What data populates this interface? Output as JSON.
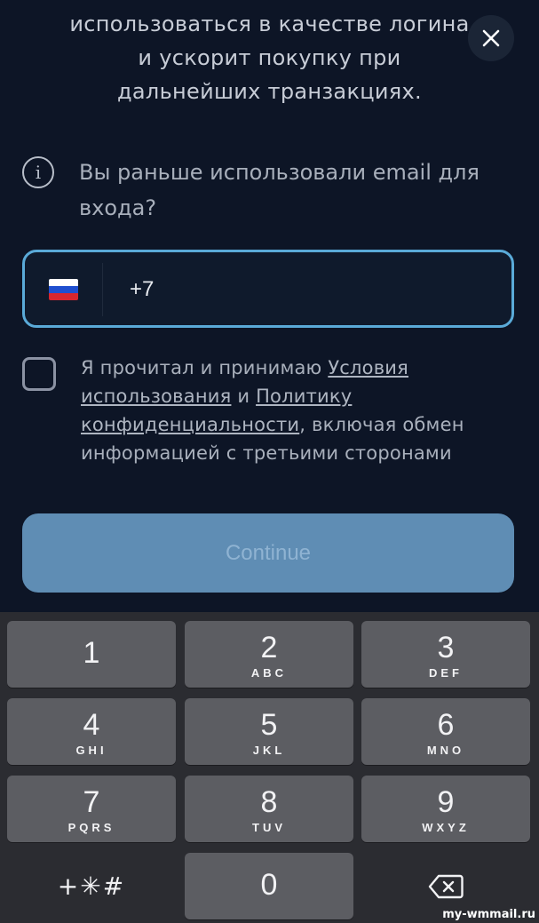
{
  "intro": {
    "line1": "использоваться в качестве логина",
    "line2": "и ускорит покупку при",
    "line3": "дальнейших транзакциях."
  },
  "close_icon": "close-icon",
  "info": {
    "icon": "info-icon",
    "text": "Вы раньше использовали email для входа?"
  },
  "phone": {
    "country_flag": "russia-flag",
    "value": "+7"
  },
  "consent": {
    "checked": false,
    "text_before": "Я прочитал и принимаю ",
    "terms_link": "Условия использования",
    "and": " и ",
    "privacy_link": "Политику конфиденциальности",
    "text_after": ", включая обмен информацией с третьими сторонами"
  },
  "continue_label": "Continue",
  "keyboard": {
    "k1": {
      "num": "1",
      "letters": ""
    },
    "k2": {
      "num": "2",
      "letters": "ABC"
    },
    "k3": {
      "num": "3",
      "letters": "DEF"
    },
    "k4": {
      "num": "4",
      "letters": "GHI"
    },
    "k5": {
      "num": "5",
      "letters": "JKL"
    },
    "k6": {
      "num": "6",
      "letters": "MNO"
    },
    "k7": {
      "num": "7",
      "letters": "PQRS"
    },
    "k8": {
      "num": "8",
      "letters": "TUV"
    },
    "k9": {
      "num": "9",
      "letters": "WXYZ"
    },
    "k0": {
      "num": "0"
    },
    "symbols": "+✳#",
    "backspace_icon": "backspace-icon"
  },
  "watermark": "my-wmmail.ru",
  "colors": {
    "background": "#0d1526",
    "field_border": "#5aaad8",
    "continue_bg": "#5f8db4",
    "keyboard_bg": "#2b2c31",
    "key_bg": "#5c5d62"
  }
}
